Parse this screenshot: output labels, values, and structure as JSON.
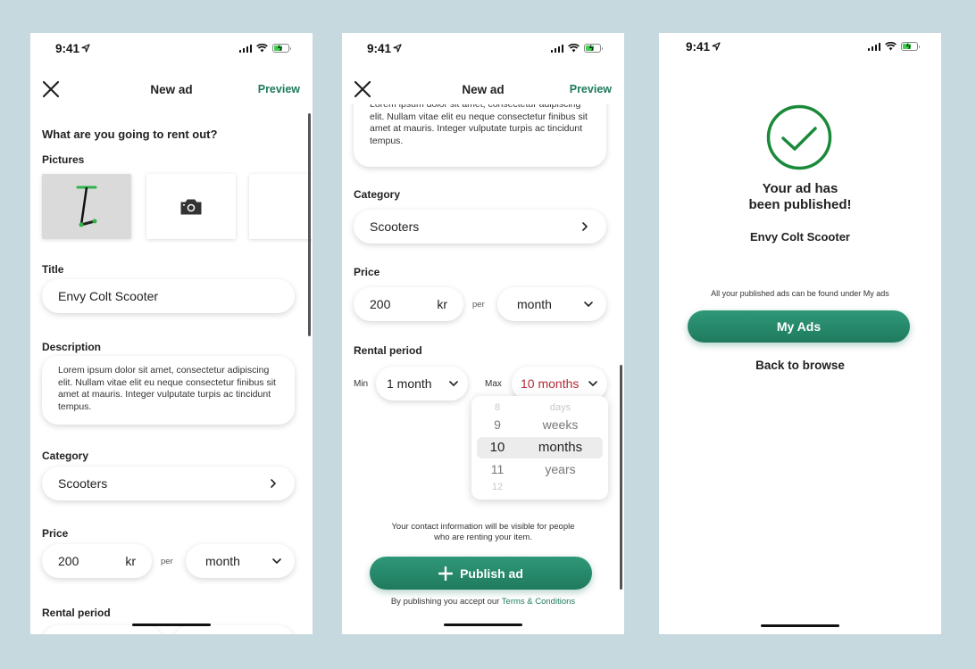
{
  "status_bar": {
    "time": "9:41"
  },
  "colors": {
    "accent": "#1e7a5c",
    "background": "#c5d9df",
    "success": "#1a8a3a",
    "selected_value": "#b02a37"
  },
  "screen1": {
    "nav": {
      "title": "New ad",
      "preview": "Preview"
    },
    "heading": "What are you going to rent out?",
    "pictures": {
      "label": "Pictures",
      "items": [
        {
          "type": "photo",
          "icon": "scooter-image"
        },
        {
          "type": "add",
          "icon": "camera-icon"
        },
        {
          "type": "empty"
        }
      ]
    },
    "title": {
      "label": "Title",
      "value": "Envy Colt Scooter"
    },
    "description": {
      "label": "Description",
      "value": "Lorem ipsum dolor sit amet, consectetur adipiscing elit. Nullam vitae elit eu neque consectetur finibus sit amet at mauris. Integer vulputate turpis ac tincidunt tempus."
    },
    "category": {
      "label": "Category",
      "value": "Scooters"
    },
    "price": {
      "label": "Price",
      "amount": "200",
      "currency": "kr",
      "per": "per",
      "unit": "month"
    },
    "rental_period": {
      "label": "Rental period"
    }
  },
  "screen2": {
    "nav": {
      "title": "New ad",
      "preview": "Preview"
    },
    "description": {
      "value": "Lorem ipsum dolor sit amet, consectetur adipiscing elit. Nullam vitae elit eu neque consectetur finibus sit amet at mauris. Integer vulputate turpis ac tincidunt tempus."
    },
    "category": {
      "label": "Category",
      "value": "Scooters"
    },
    "price": {
      "label": "Price",
      "amount": "200",
      "currency": "kr",
      "per": "per",
      "unit": "month"
    },
    "rental_period": {
      "label": "Rental period",
      "min_label": "Min",
      "min_value": "1 month",
      "max_label": "Max",
      "max_value": "10 months"
    },
    "picker": {
      "numbers": [
        "8",
        "9",
        "10",
        "11",
        "12"
      ],
      "units": [
        "days",
        "weeks",
        "months",
        "years"
      ],
      "selected_number": "10",
      "selected_unit": "months"
    },
    "contact_notice": "Your contact information will be visible for people who are renting your item.",
    "publish_button": "Publish ad",
    "terms_prefix": "By publishing you accept our ",
    "terms_link": "Terms & Conditions"
  },
  "screen3": {
    "heading_line1": "Your ad has",
    "heading_line2": "been published!",
    "item_name": "Envy Colt Scooter",
    "notice": "All your published ads can be found under My ads",
    "my_ads_button": "My Ads",
    "back_button": "Back to browse"
  }
}
